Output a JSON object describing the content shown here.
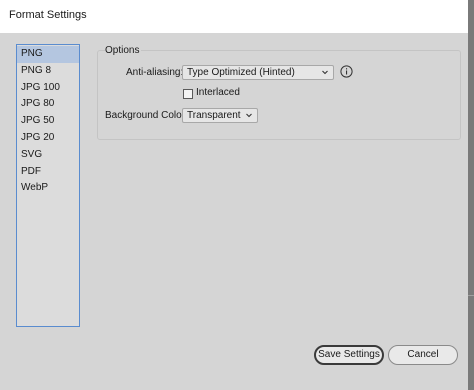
{
  "window": {
    "title": "Format Settings"
  },
  "formats": {
    "items": [
      "PNG",
      "PNG 8",
      "JPG 100",
      "JPG 80",
      "JPG 50",
      "JPG 20",
      "SVG",
      "PDF",
      "WebP"
    ],
    "selected": "PNG"
  },
  "options": {
    "group_title": "Options",
    "anti_aliasing": {
      "label": "Anti-aliasing:",
      "value": "Type Optimized (Hinted)"
    },
    "interlaced": {
      "label": "Interlaced",
      "checked": false
    },
    "background_color": {
      "label": "Background Color:",
      "value": "Transparent"
    }
  },
  "icons": {
    "info": "info-icon",
    "chevron": "chevron-down-icon"
  },
  "buttons": {
    "save": "Save Settings",
    "cancel": "Cancel"
  },
  "colors": {
    "list_border": "#5a8ccf",
    "selected_row": "#b4c6e0",
    "panel_bg": "#d5d5d5"
  }
}
